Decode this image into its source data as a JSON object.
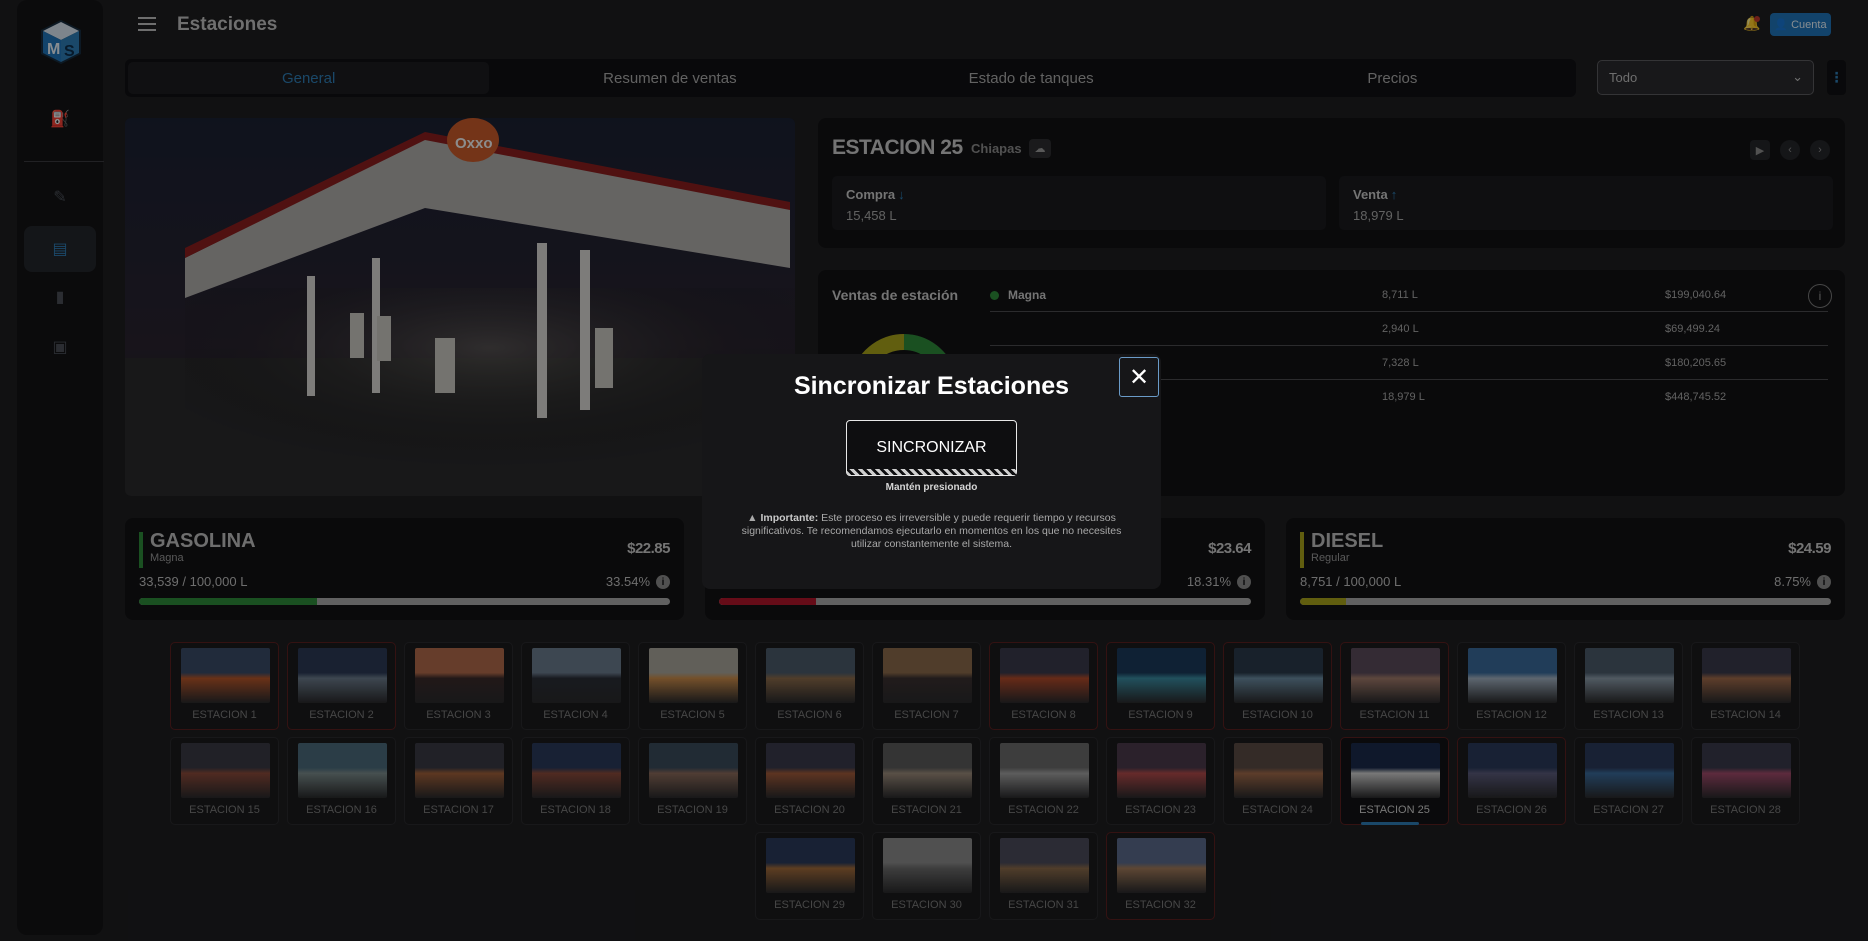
{
  "header": {
    "title": "Estaciones",
    "account_label": "Cuenta"
  },
  "sidebar": {
    "icons": [
      "pump-icon",
      "fuel-gun-icon",
      "station-icon",
      "chart-icon",
      "briefcase-icon"
    ]
  },
  "tabs": [
    {
      "label": "General",
      "active": true
    },
    {
      "label": "Resumen de ventas"
    },
    {
      "label": "Estado de tanques"
    },
    {
      "label": "Precios"
    }
  ],
  "filter": {
    "selected": "Todo"
  },
  "station": {
    "name": "ESTACION 25",
    "state": "Chiapas",
    "compra_label": "Compra",
    "compra_value": "15,458 L",
    "venta_label": "Venta",
    "venta_value": "18,979 L"
  },
  "sales": {
    "title": "Ventas de estación",
    "rows": [
      {
        "name": "Magna",
        "liters": "8,711 L",
        "amount": "$199,040.64",
        "color": "#2e8b3a"
      },
      {
        "name": "",
        "liters": "2,940 L",
        "amount": "$69,499.24",
        "color": ""
      },
      {
        "name": "",
        "liters": "7,328 L",
        "amount": "$180,205.65",
        "color": ""
      },
      {
        "name": "",
        "liters": "18,979 L",
        "amount": "$448,745.52",
        "color": ""
      }
    ]
  },
  "fuels": [
    {
      "name": "GASOLINA",
      "sub": "Magna",
      "price": "$22.85",
      "capacity": "33,539 / 100,000 L",
      "percent_label": "33.54%",
      "level": 0.3354,
      "color": "#2e8b3a"
    },
    {
      "name": "",
      "sub": "",
      "price": "$23.64",
      "capacity": "",
      "percent_label": "18.31%",
      "level": 0.1831,
      "color": "#b0152a"
    },
    {
      "name": "DIESEL",
      "sub": "Regular",
      "price": "$24.59",
      "capacity": "8,751 / 100,000 L",
      "percent_label": "8.75%",
      "level": 0.0875,
      "color": "#a8a21a"
    }
  ],
  "stations": [
    "ESTACION 1",
    "ESTACION 2",
    "ESTACION 3",
    "ESTACION 4",
    "ESTACION 5",
    "ESTACION 6",
    "ESTACION 7",
    "ESTACION 8",
    "ESTACION 9",
    "ESTACION 10",
    "ESTACION 11",
    "ESTACION 12",
    "ESTACION 13",
    "ESTACION 14",
    "ESTACION 15",
    "ESTACION 16",
    "ESTACION 17",
    "ESTACION 18",
    "ESTACION 19",
    "ESTACION 20",
    "ESTACION 21",
    "ESTACION 22",
    "ESTACION 23",
    "ESTACION 24",
    "ESTACION 25",
    "ESTACION 26",
    "ESTACION 27",
    "ESTACION 28",
    "ESTACION 29",
    "ESTACION 30",
    "ESTACION 31",
    "ESTACION 32"
  ],
  "modal": {
    "title": "Sincronizar Estaciones",
    "button": "SINCRONIZAR",
    "hold": "Mantén presionado",
    "note_bold": "Importante:",
    "note_text": "Este proceso es irreversible y puede requerir tiempo y recursos significativos. Te recomendamos ejecutarlo en momentos en los que no necesites utilizar constantemente el sistema."
  }
}
